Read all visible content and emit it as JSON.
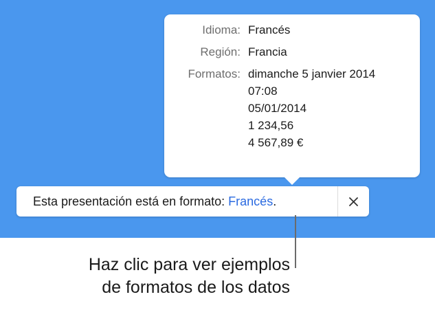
{
  "popover": {
    "rows": [
      {
        "label": "Idioma:",
        "value": "Francés"
      },
      {
        "label": "Región:",
        "value": "Francia"
      },
      {
        "label": "Formatos:",
        "values": [
          "dimanche 5 janvier 2014",
          "07:08",
          "05/01/2014",
          "1 234,56",
          "4 567,89 €"
        ]
      }
    ]
  },
  "banner": {
    "text": "Esta presentación está en formato: ",
    "link": "Francés",
    "suffix": ".",
    "close_icon": "close-icon"
  },
  "caption": {
    "line1": "Haz clic para ver ejemplos",
    "line2": "de formatos de los datos"
  },
  "colors": {
    "background_blue": "#4a97ee",
    "link_blue": "#2a6ae0",
    "label_gray": "#6e6e6e"
  }
}
